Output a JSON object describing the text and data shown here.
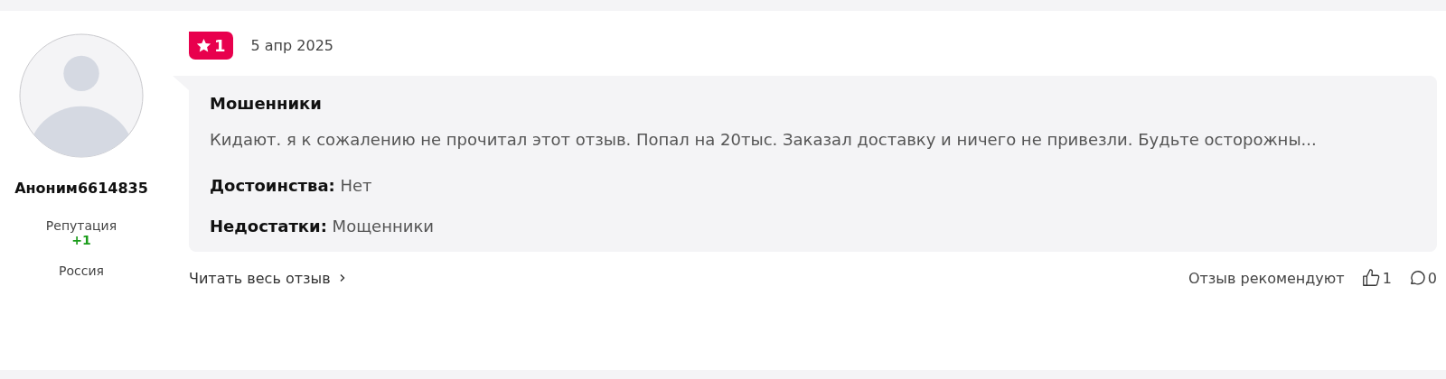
{
  "author": {
    "name": "Аноним6614835",
    "reputation_label": "Репутация",
    "reputation": "+1",
    "country": "Россия"
  },
  "review": {
    "rating": "1",
    "date": "5 апр 2025",
    "title": "Мошенники",
    "text": "Кидают. я к сожалению не прочитал этот отзыв. Попал на 20тыс. Заказал доставку и ничего не привезли. Будьте осторожны...",
    "fields": [
      {
        "label": "Достоинства:",
        "value": "Нет"
      },
      {
        "label": "Недостатки:",
        "value": "Мощенники"
      }
    ]
  },
  "footer": {
    "read_more": "Читать весь отзыв",
    "recommend_label": "Отзыв рекомендуют",
    "likes": "1",
    "comments": "0"
  }
}
